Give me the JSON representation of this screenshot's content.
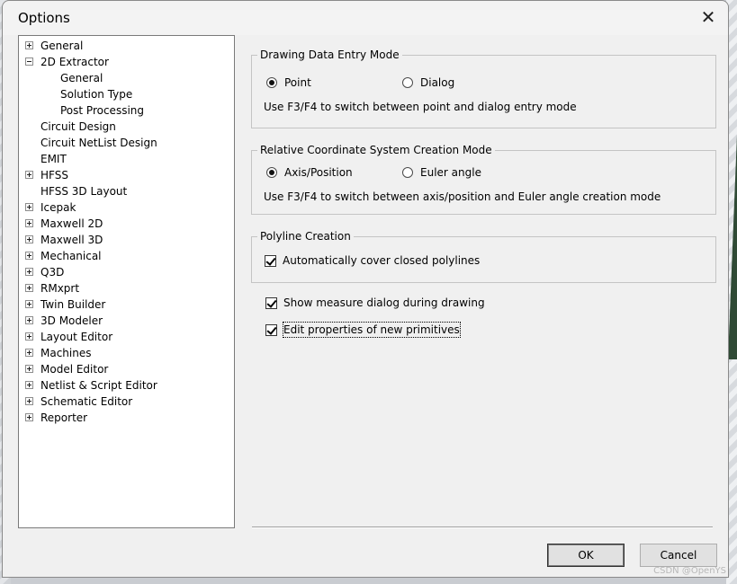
{
  "window": {
    "title": "Options",
    "close_glyph": "✕"
  },
  "tree": {
    "items": [
      {
        "label": "General",
        "expander": "plus",
        "indent": 0
      },
      {
        "label": "2D Extractor",
        "expander": "minus",
        "indent": 0
      },
      {
        "label": "General",
        "expander": "none",
        "indent": 2
      },
      {
        "label": "Solution Type",
        "expander": "none",
        "indent": 2
      },
      {
        "label": "Post Processing",
        "expander": "none",
        "indent": 2
      },
      {
        "label": "Circuit Design",
        "expander": "none",
        "indent": 0
      },
      {
        "label": "Circuit NetList Design",
        "expander": "none",
        "indent": 0
      },
      {
        "label": "EMIT",
        "expander": "none",
        "indent": 0
      },
      {
        "label": "HFSS",
        "expander": "plus",
        "indent": 0
      },
      {
        "label": "HFSS 3D Layout",
        "expander": "none",
        "indent": 0
      },
      {
        "label": "Icepak",
        "expander": "plus",
        "indent": 0
      },
      {
        "label": "Maxwell 2D",
        "expander": "plus",
        "indent": 0
      },
      {
        "label": "Maxwell 3D",
        "expander": "plus",
        "indent": 0
      },
      {
        "label": "Mechanical",
        "expander": "plus",
        "indent": 0
      },
      {
        "label": "Q3D",
        "expander": "plus",
        "indent": 0
      },
      {
        "label": "RMxprt",
        "expander": "plus",
        "indent": 0
      },
      {
        "label": "Twin Builder",
        "expander": "plus",
        "indent": 0
      },
      {
        "label": "3D Modeler",
        "expander": "plus",
        "indent": 0
      },
      {
        "label": "Layout Editor",
        "expander": "plus",
        "indent": 0
      },
      {
        "label": "Machines",
        "expander": "plus",
        "indent": 0
      },
      {
        "label": "Model Editor",
        "expander": "plus",
        "indent": 0
      },
      {
        "label": "Netlist & Script Editor",
        "expander": "plus",
        "indent": 0
      },
      {
        "label": "Schematic Editor",
        "expander": "plus",
        "indent": 0
      },
      {
        "label": "Reporter",
        "expander": "plus",
        "indent": 0
      }
    ]
  },
  "drawing_mode": {
    "title": "Drawing Data Entry Mode",
    "option_point": "Point",
    "option_dialog": "Dialog",
    "selected": "Point",
    "hint": "Use F3/F4 to switch between point and dialog entry mode"
  },
  "coord_mode": {
    "title": "Relative Coordinate System Creation Mode",
    "option_axis": "Axis/Position",
    "option_euler": "Euler angle",
    "selected": "Axis/Position",
    "hint": "Use F3/F4 to switch between axis/position and Euler angle creation mode"
  },
  "polyline": {
    "title": "Polyline Creation",
    "cover_label": "Automatically cover closed polylines",
    "cover_checked": true
  },
  "misc": {
    "measure_label": "Show measure dialog during drawing",
    "measure_checked": true,
    "edit_props_label": "Edit properties of new primitives",
    "edit_props_checked": true
  },
  "buttons": {
    "ok": "OK",
    "cancel": "Cancel"
  },
  "watermark": "CSDN @OpenYS"
}
